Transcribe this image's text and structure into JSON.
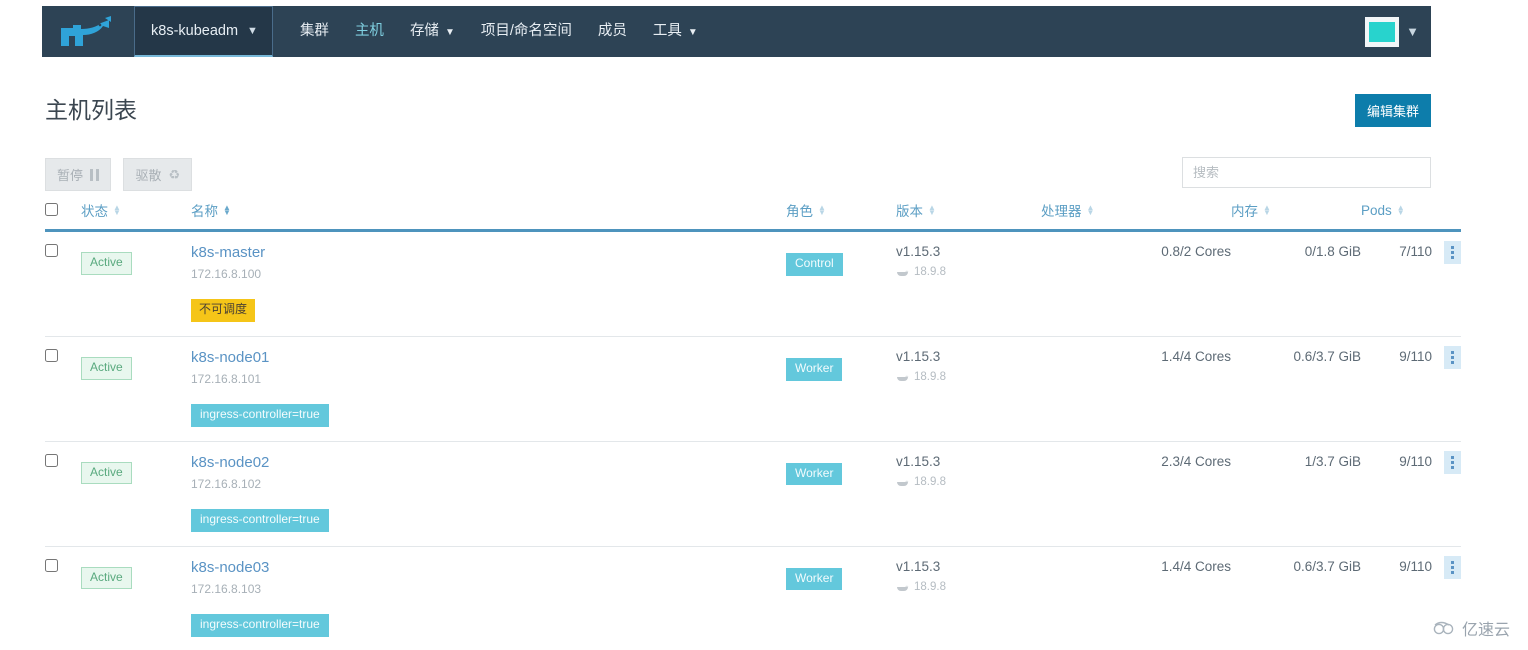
{
  "navbar": {
    "logo_name": "rancher-cow-logo",
    "cluster_selector": {
      "label": "k8s-kubeadm",
      "caret": "⌄"
    },
    "links": [
      {
        "label": "集群",
        "active": false,
        "has_caret": false
      },
      {
        "label": "主机",
        "active": true,
        "has_caret": false
      },
      {
        "label": "存储",
        "active": false,
        "has_caret": true
      },
      {
        "label": "项目/命名空间",
        "active": false,
        "has_caret": false
      },
      {
        "label": "成员",
        "active": false,
        "has_caret": false
      },
      {
        "label": "工具",
        "active": false,
        "has_caret": true
      }
    ],
    "avatar_caret": "⌄",
    "colors": {
      "navbar_bg": "#2d4355",
      "active_link": "#7fcfe0",
      "avatar": "#28d3cd"
    }
  },
  "header": {
    "title": "主机列表",
    "edit_cluster_label": "编辑集群",
    "edit_cluster_color": "#0d7dab"
  },
  "toolbar": {
    "pause_label": "暂停",
    "evict_label": "驱散",
    "evict_icon": "♻",
    "search_placeholder": "搜索",
    "search_value": ""
  },
  "table": {
    "columns": [
      {
        "key": "state",
        "label": "状态",
        "sorted": false
      },
      {
        "key": "name",
        "label": "名称",
        "sorted": true
      },
      {
        "key": "role",
        "label": "角色",
        "sorted": false
      },
      {
        "key": "version",
        "label": "版本",
        "sorted": false
      },
      {
        "key": "cpu",
        "label": "处理器",
        "sorted": false
      },
      {
        "key": "memory",
        "label": "内存",
        "sorted": false
      },
      {
        "key": "pods",
        "label": "Pods",
        "sorted": false
      }
    ],
    "rows": [
      {
        "state": "Active",
        "name": "k8s-master",
        "ip": "172.16.8.100",
        "tag": "不可调度",
        "tag_kind": "warn",
        "role": "Control",
        "version": "v1.15.3",
        "docker_version": "18.9.8",
        "cpu": "0.8/2 Cores",
        "memory": "0/1.8 GiB",
        "pods": "7/110"
      },
      {
        "state": "Active",
        "name": "k8s-node01",
        "ip": "172.16.8.101",
        "tag": "ingress-controller=true",
        "tag_kind": "label",
        "role": "Worker",
        "version": "v1.15.3",
        "docker_version": "18.9.8",
        "cpu": "1.4/4 Cores",
        "memory": "0.6/3.7 GiB",
        "pods": "9/110"
      },
      {
        "state": "Active",
        "name": "k8s-node02",
        "ip": "172.16.8.102",
        "tag": "ingress-controller=true",
        "tag_kind": "label",
        "role": "Worker",
        "version": "v1.15.3",
        "docker_version": "18.9.8",
        "cpu": "2.3/4 Cores",
        "memory": "1/3.7 GiB",
        "pods": "9/110"
      },
      {
        "state": "Active",
        "name": "k8s-node03",
        "ip": "172.16.8.103",
        "tag": "ingress-controller=true",
        "tag_kind": "label",
        "role": "Worker",
        "version": "v1.15.3",
        "docker_version": "18.9.8",
        "cpu": "1.4/4 Cores",
        "memory": "0.6/3.7 GiB",
        "pods": "9/110"
      }
    ]
  },
  "watermark": {
    "text": "亿速云"
  }
}
